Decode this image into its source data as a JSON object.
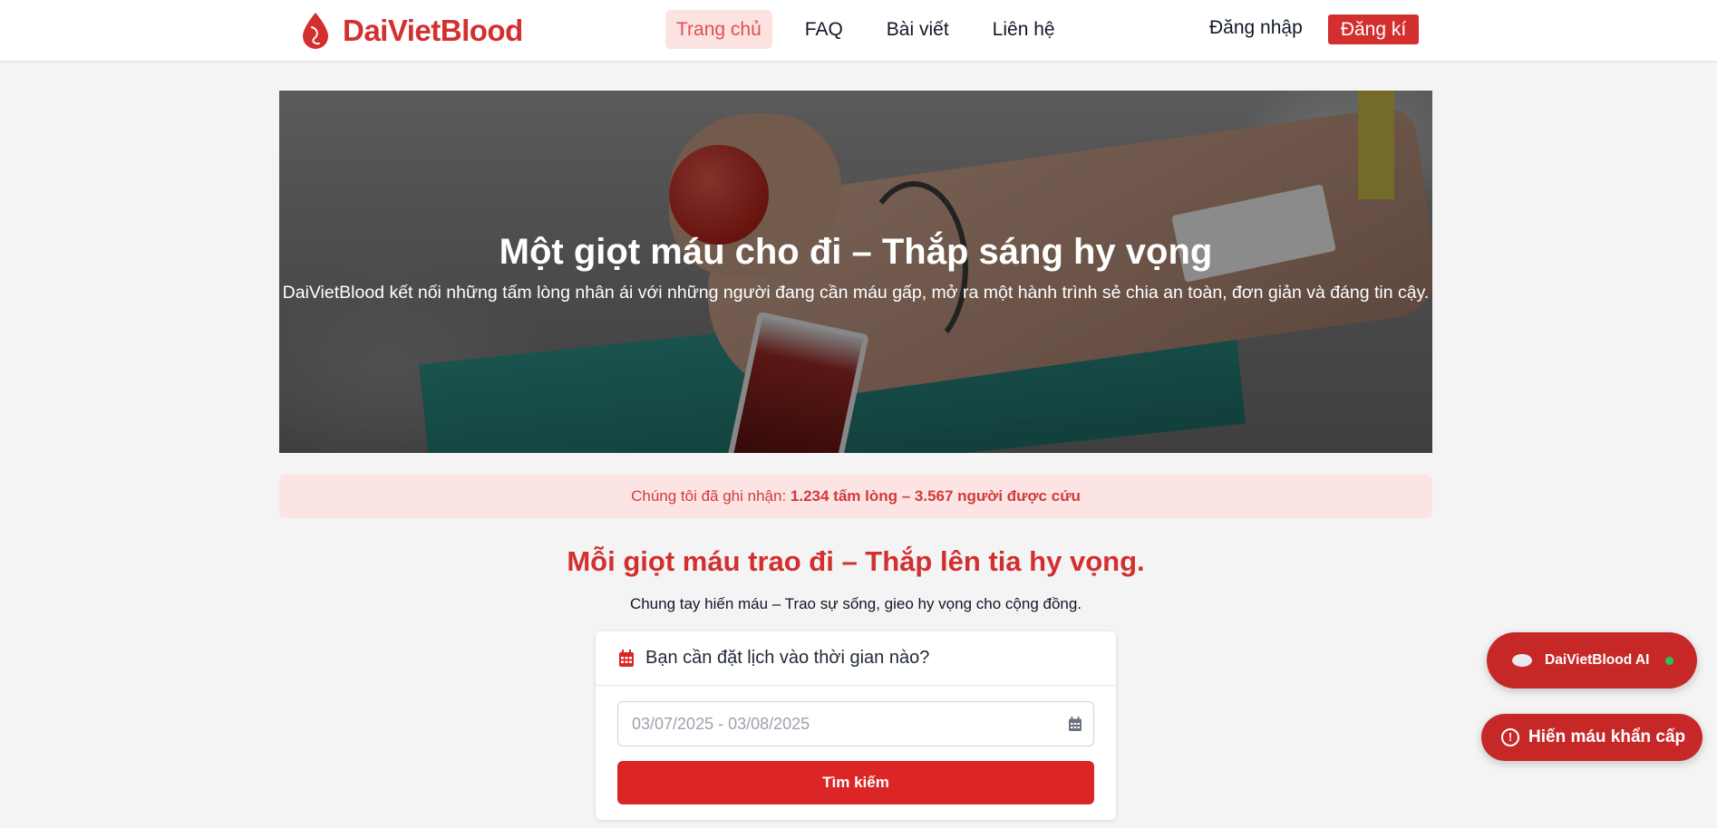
{
  "brand": {
    "name": "DaiVietBlood",
    "color": "#d32f2f"
  },
  "nav": {
    "items": [
      {
        "label": "Trang chủ",
        "active": true
      },
      {
        "label": "FAQ",
        "active": false
      },
      {
        "label": "Bài viết",
        "active": false
      },
      {
        "label": "Liên hệ",
        "active": false
      }
    ],
    "login_label": "Đăng nhập",
    "register_label": "Đăng kí"
  },
  "hero": {
    "title": "Một giọt máu cho đi – Thắp sáng hy vọng",
    "subtitle": "DaiVietBlood kết nối những tấm lòng nhân ái với những người đang cần máu gấp, mở ra một hành trình sẻ chia an toàn, đơn giản và đáng tin cậy."
  },
  "stats": {
    "prefix": "Chúng tôi đã ghi nhận: ",
    "highlight": "1.234 tấm lòng – 3.567 người được cứu"
  },
  "section": {
    "title": "Mỗi giọt máu trao đi – Thắp lên tia hy vọng.",
    "subtitle": "Chung tay hiến máu – Trao sự sống, gieo hy vọng cho cộng đồng."
  },
  "booking": {
    "question": "Bạn cần đặt lịch vào thời gian nào?",
    "date_placeholder": "03/07/2025 - 03/08/2025",
    "search_label": "Tìm kiếm"
  },
  "floating": {
    "ai_label": "DaiVietBlood AI",
    "ai_status_color": "#22c55e",
    "urgent_label": "Hiến máu khẩn cấp"
  },
  "icons": [
    "blood-drop-logo-icon",
    "calendar-icon",
    "calendar-field-icon",
    "chat-bubble-icon",
    "online-status-icon",
    "alert-circle-icon"
  ]
}
